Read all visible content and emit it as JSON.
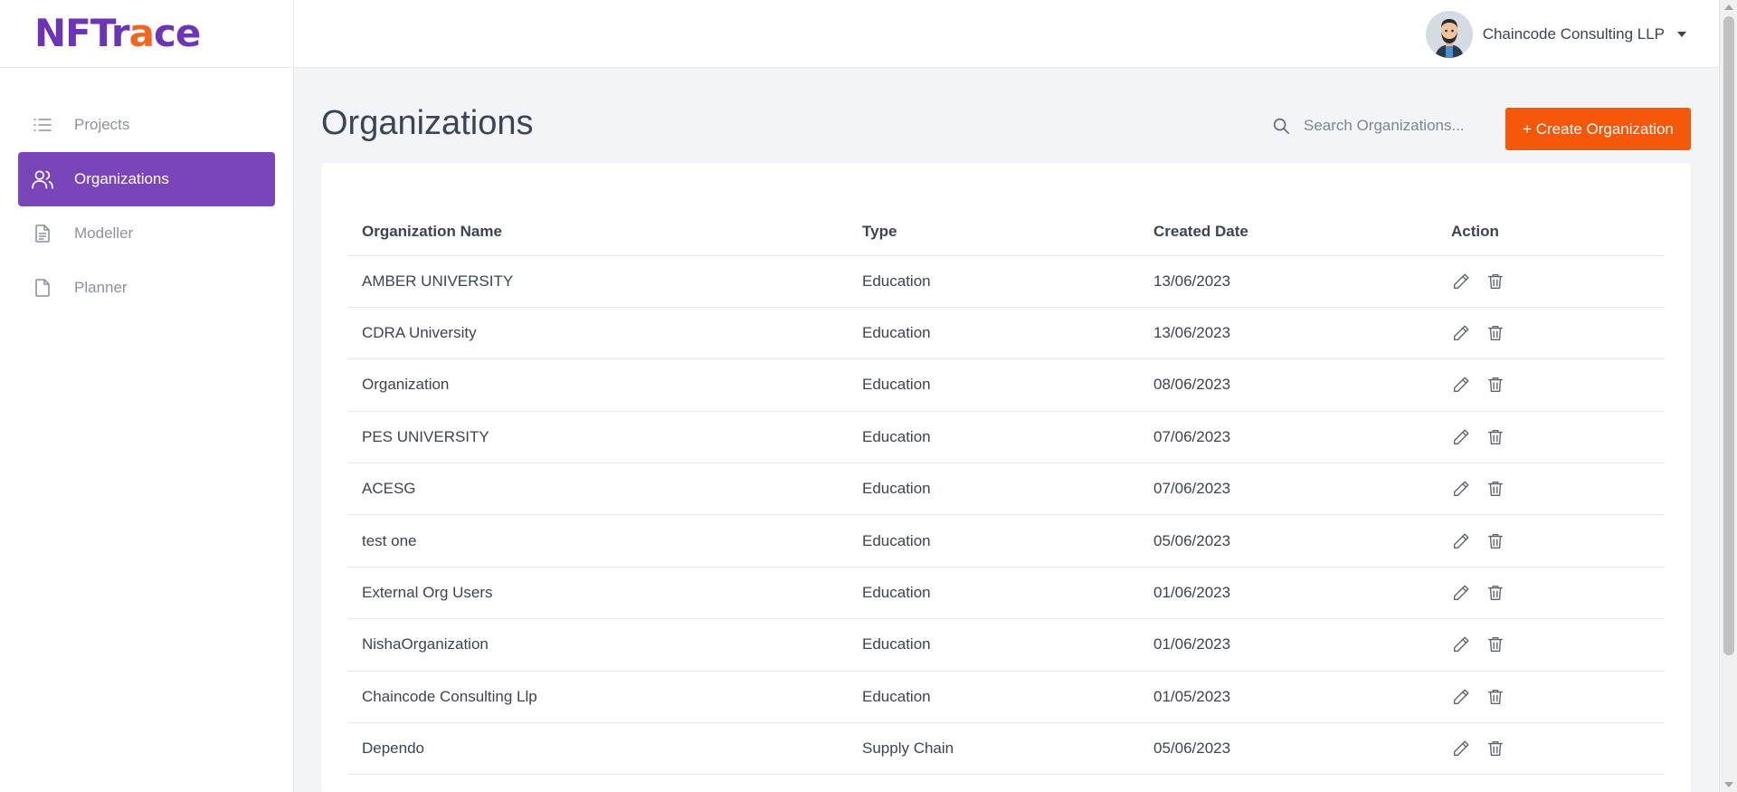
{
  "brand": {
    "logo_main": "NFTr",
    "logo_accent": "a",
    "logo_end": "ce",
    "primary_color": "#6b35b5",
    "accent_color": "#f26522"
  },
  "sidebar": {
    "items": [
      {
        "label": "Projects",
        "icon": "list-icon",
        "active": false
      },
      {
        "label": "Organizations",
        "icon": "users-icon",
        "active": true
      },
      {
        "label": "Modeller",
        "icon": "document-icon",
        "active": false
      },
      {
        "label": "Planner",
        "icon": "file-icon",
        "active": false
      }
    ]
  },
  "header": {
    "user_name": "Chaincode Consulting LLP"
  },
  "main": {
    "title": "Organizations",
    "search_placeholder": "Search Organizations...",
    "create_label": "+ Create Organization",
    "create_color": "#f5570b"
  },
  "table": {
    "columns": [
      "Organization Name",
      "Type",
      "Created Date",
      "Action"
    ],
    "rows": [
      {
        "name": "AMBER UNIVERSITY",
        "type": "Education",
        "date": "13/06/2023"
      },
      {
        "name": "CDRA University",
        "type": "Education",
        "date": "13/06/2023"
      },
      {
        "name": "Organization",
        "type": "Education",
        "date": "08/06/2023"
      },
      {
        "name": "PES UNIVERSITY",
        "type": "Education",
        "date": "07/06/2023"
      },
      {
        "name": "ACESG",
        "type": "Education",
        "date": "07/06/2023"
      },
      {
        "name": "test one",
        "type": "Education",
        "date": "05/06/2023"
      },
      {
        "name": "External Org Users",
        "type": "Education",
        "date": "01/06/2023"
      },
      {
        "name": "NishaOrganization",
        "type": "Education",
        "date": "01/06/2023"
      },
      {
        "name": "Chaincode Consulting Llp",
        "type": "Education",
        "date": "01/05/2023"
      },
      {
        "name": "Dependo",
        "type": "Supply Chain",
        "date": "05/06/2023"
      }
    ]
  }
}
